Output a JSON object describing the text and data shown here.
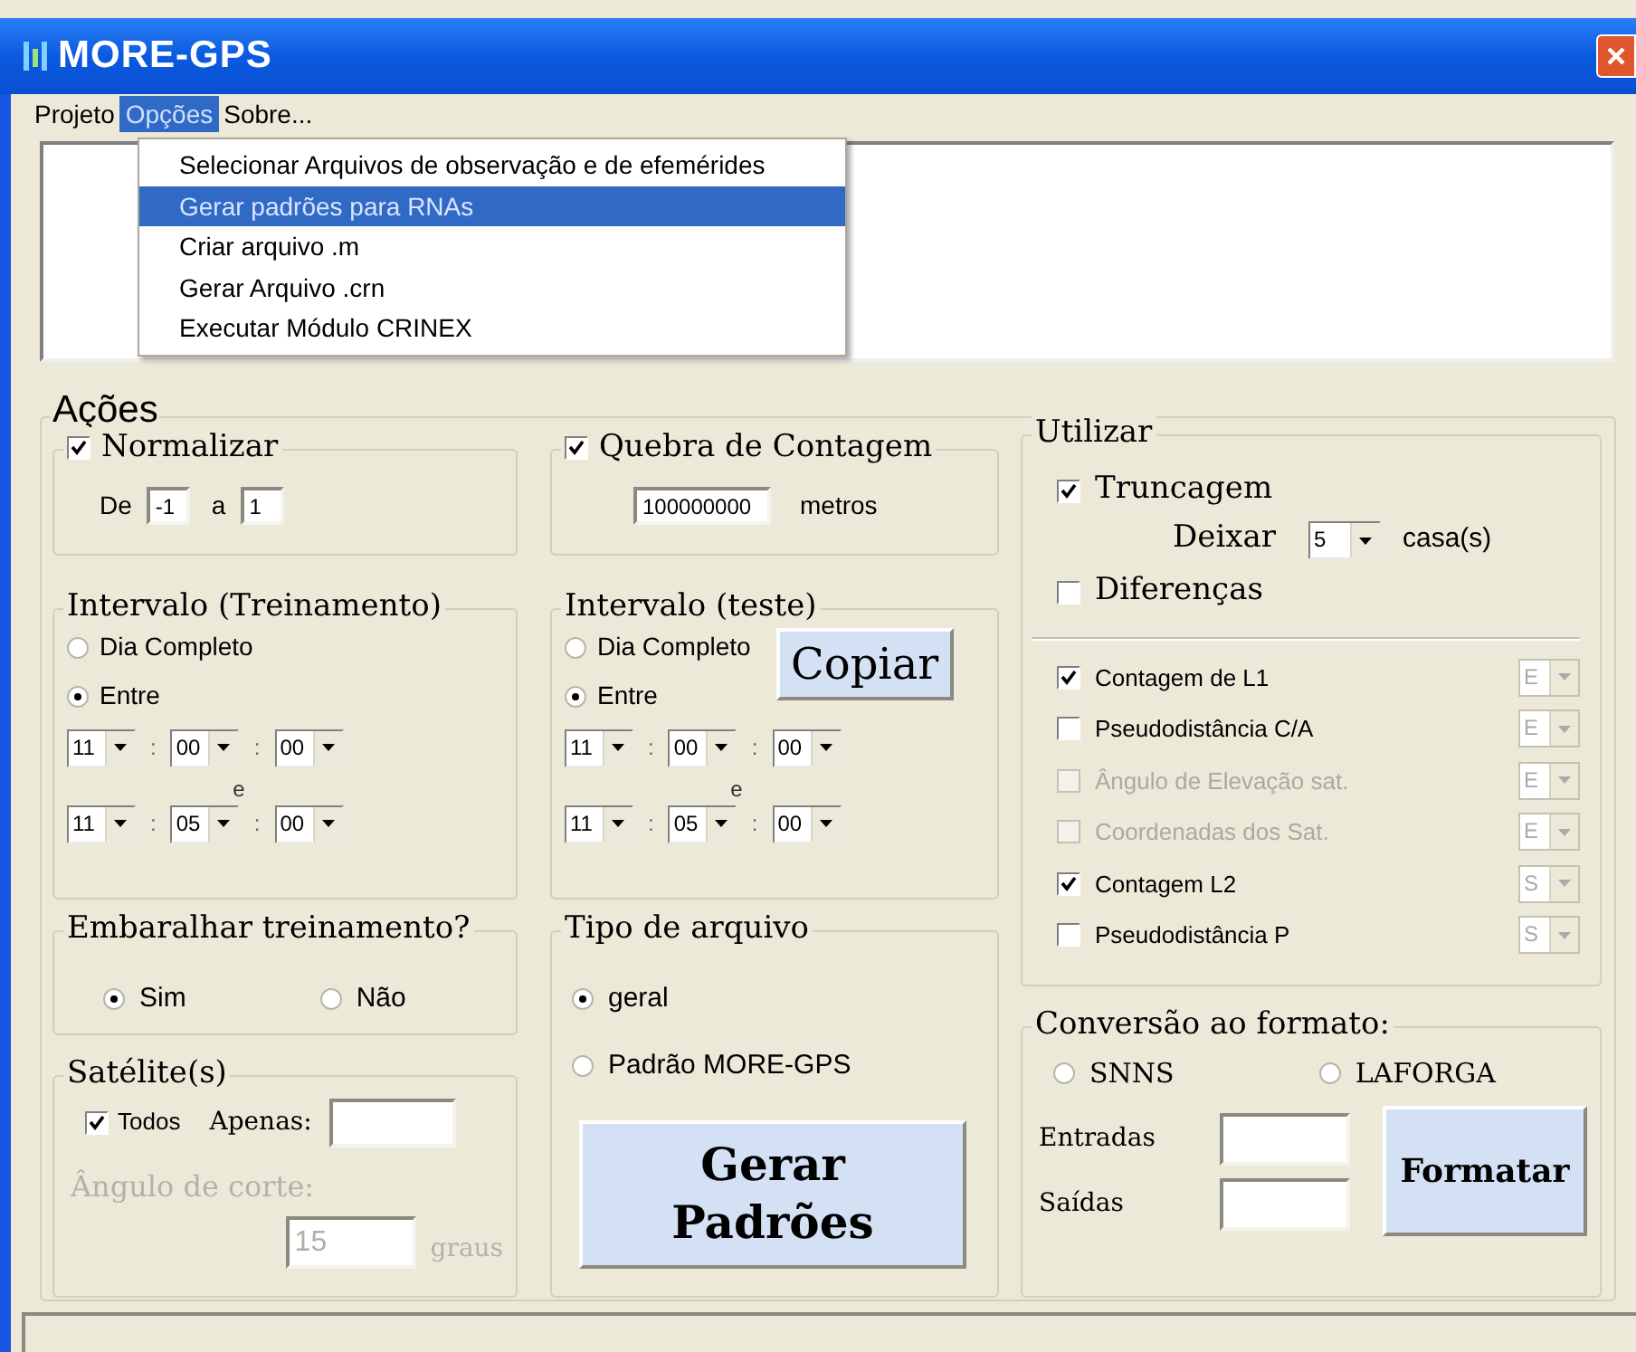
{
  "window": {
    "title": "MORE-GPS"
  },
  "menu_bar": [
    {
      "label": "Projeto",
      "selected": false
    },
    {
      "label": "Opções",
      "selected": true
    },
    {
      "label": "Sobre...",
      "selected": false
    }
  ],
  "dropdown_menu": [
    {
      "label": "Selecionar Arquivos de observação e de efemérides",
      "selected": false
    },
    {
      "label": "Gerar padrões para RNAs",
      "selected": true
    },
    {
      "label": "Criar arquivo .m",
      "selected": false
    },
    {
      "label": "Gerar Arquivo .crn",
      "selected": false
    },
    {
      "label": "Executar Módulo CRINEX",
      "selected": false
    }
  ],
  "acoes": {
    "title": "Ações",
    "normalizar": {
      "label": "Normalizar",
      "checked": true,
      "from_label": "De",
      "from": "-1",
      "to_label": "a",
      "to": "1"
    },
    "quebra": {
      "label": "Quebra de Contagem",
      "checked": true,
      "value": "100000000",
      "unit": "metros"
    },
    "intervals": [
      {
        "title": "Intervalo (Treinamento)",
        "options": [
          {
            "label": "Dia Completo",
            "selected": false
          },
          {
            "label": "Entre",
            "selected": true
          }
        ],
        "start": [
          {
            "kind": "combo",
            "value": "11"
          },
          {
            "kind": "sep",
            "value": ":"
          },
          {
            "kind": "combo",
            "value": "00"
          },
          {
            "kind": "sep",
            "value": ":"
          },
          {
            "kind": "combo",
            "value": "00"
          }
        ],
        "separator": "e",
        "end": [
          {
            "kind": "combo",
            "value": "11"
          },
          {
            "kind": "sep",
            "value": ":"
          },
          {
            "kind": "combo",
            "value": "05"
          },
          {
            "kind": "sep",
            "value": ":"
          },
          {
            "kind": "combo",
            "value": "00"
          }
        ]
      },
      {
        "title": "Intervalo (teste)",
        "options": [
          {
            "label": "Dia Completo",
            "selected": false
          },
          {
            "label": "Entre",
            "selected": true
          }
        ],
        "button": "Copiar",
        "start": [
          {
            "kind": "combo",
            "value": "11"
          },
          {
            "kind": "sep",
            "value": ":"
          },
          {
            "kind": "combo",
            "value": "00"
          },
          {
            "kind": "sep",
            "value": ":"
          },
          {
            "kind": "combo",
            "value": "00"
          }
        ],
        "separator": "e",
        "end": [
          {
            "kind": "combo",
            "value": "11"
          },
          {
            "kind": "sep",
            "value": ":"
          },
          {
            "kind": "combo",
            "value": "05"
          },
          {
            "kind": "sep",
            "value": ":"
          },
          {
            "kind": "combo",
            "value": "00"
          }
        ]
      }
    ],
    "embaralhar": {
      "title": "Embaralhar treinamento?",
      "options": [
        {
          "label": "Sim",
          "selected": true
        },
        {
          "label": "Não",
          "selected": false
        }
      ]
    },
    "satelite": {
      "title": "Satélite(s)",
      "todos": {
        "label": "Todos",
        "checked": true
      },
      "apenas_label": "Apenas:",
      "angulo_label": "Ângulo de corte:",
      "angulo_disabled": true,
      "angulo_value": "15",
      "angulo_unit": "graus"
    },
    "tipo": {
      "title": "Tipo de arquivo",
      "options": [
        {
          "label": "geral",
          "selected": true
        },
        {
          "label": "Padrão MORE-GPS",
          "selected": false
        }
      ],
      "button_lines": [
        "Gerar",
        "Padrões"
      ]
    },
    "utilizar": {
      "title": "Utilizar",
      "truncagem": {
        "label": "Truncagem",
        "checked": true
      },
      "deixar_label": "Deixar",
      "deixar_value": "5",
      "deixar_unit": "casa(s)",
      "diferencas": {
        "label": "Diferenças",
        "checked": false
      },
      "items": [
        {
          "label": "Contagem de L1",
          "checked": true,
          "disabled": false,
          "combo": "E"
        },
        {
          "label": "Pseudodistância C/A",
          "checked": false,
          "disabled": false,
          "combo": "E"
        },
        {
          "label": "Ângulo de Elevação sat.",
          "checked": false,
          "disabled": true,
          "combo": "E"
        },
        {
          "label": "Coordenadas dos Sat.",
          "checked": false,
          "disabled": true,
          "combo": "E"
        },
        {
          "label": "Contagem L2",
          "checked": true,
          "disabled": false,
          "combo": "S"
        },
        {
          "label": "Pseudodistância P",
          "checked": false,
          "disabled": false,
          "combo": "S"
        }
      ]
    },
    "conversao": {
      "title": "Conversão ao formato:",
      "options": [
        {
          "label": "SNNS",
          "selected": false
        },
        {
          "label": "LAFORGA",
          "selected": false
        }
      ],
      "fields": [
        {
          "label": "Entradas"
        },
        {
          "label": "Saídas"
        }
      ],
      "button": "Formatar"
    }
  }
}
